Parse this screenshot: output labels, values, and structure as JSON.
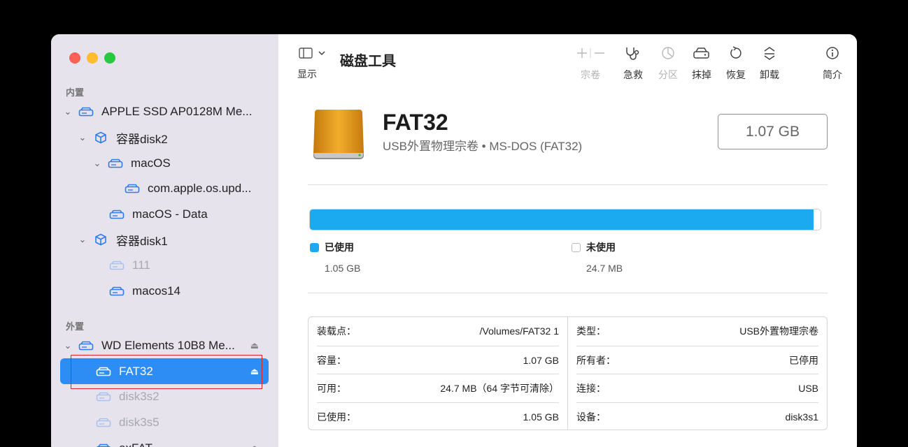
{
  "toolbar": {
    "display_label": "显示",
    "title": "磁盘工具",
    "volume_label": "宗卷",
    "firstaid_label": "急救",
    "partition_label": "分区",
    "erase_label": "抹掉",
    "restore_label": "恢复",
    "unmount_label": "卸载",
    "info_label": "简介"
  },
  "sidebar": {
    "internal_title": "内置",
    "external_title": "外置",
    "items": [
      {
        "label": "APPLE SSD AP0128M Me..."
      },
      {
        "label": "容器disk2"
      },
      {
        "label": "macOS"
      },
      {
        "label": "com.apple.os.upd..."
      },
      {
        "label": "macOS - Data"
      },
      {
        "label": "容器disk1"
      },
      {
        "label": "111"
      },
      {
        "label": "macos14"
      },
      {
        "label": "WD Elements 10B8 Me..."
      },
      {
        "label": "FAT32"
      },
      {
        "label": "disk3s2"
      },
      {
        "label": "disk3s5"
      },
      {
        "label": "exFAT"
      }
    ]
  },
  "volume": {
    "name": "FAT32",
    "subtitle": "USB外置物理宗卷 • MS-DOS (FAT32)",
    "size": "1.07 GB"
  },
  "usage": {
    "used_fraction": 0.986,
    "used_label": "已使用",
    "used_value": "1.05 GB",
    "free_label": "未使用",
    "free_value": "24.7 MB"
  },
  "info": {
    "left": [
      {
        "key": "装载点：",
        "value": "/Volumes/FAT32 1"
      },
      {
        "key": "容量：",
        "value": "1.07 GB"
      },
      {
        "key": "可用：",
        "value": "24.7 MB（64 字节可清除）"
      },
      {
        "key": "已使用：",
        "value": "1.05 GB"
      }
    ],
    "right": [
      {
        "key": "类型：",
        "value": "USB外置物理宗卷"
      },
      {
        "key": "所有者：",
        "value": "已停用"
      },
      {
        "key": "连接：",
        "value": "USB"
      },
      {
        "key": "设备：",
        "value": "disk3s1"
      }
    ]
  },
  "colors": {
    "accent": "#2e8cf5",
    "used": "#1baaf0"
  }
}
